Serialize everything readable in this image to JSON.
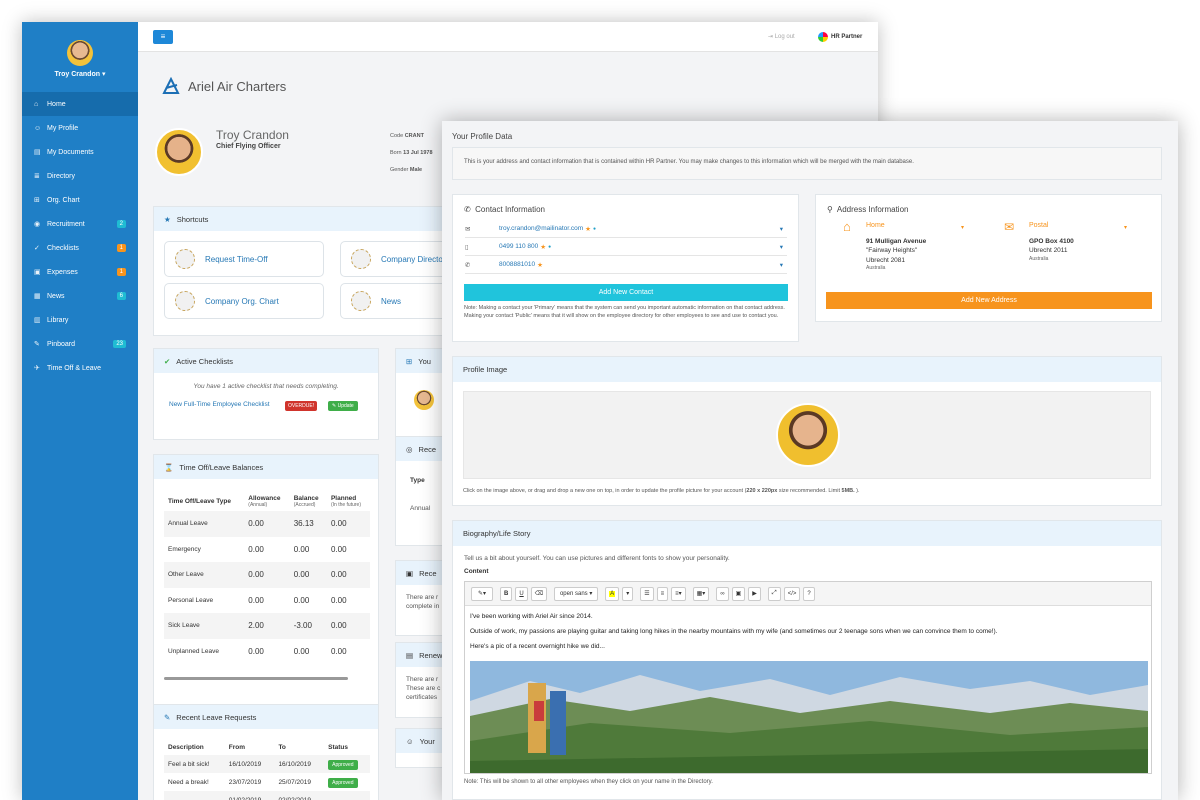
{
  "sidebar": {
    "user_name": "Troy Crandon",
    "items": [
      {
        "label": "Home",
        "icon": "home-icon",
        "glyph": "⌂"
      },
      {
        "label": "My Profile",
        "icon": "user-icon",
        "glyph": "☺"
      },
      {
        "label": "My Documents",
        "icon": "file-icon",
        "glyph": "▤"
      },
      {
        "label": "Directory",
        "icon": "list-icon",
        "glyph": "≣"
      },
      {
        "label": "Org. Chart",
        "icon": "sitemap-icon",
        "glyph": "⊞"
      },
      {
        "label": "Recruitment",
        "icon": "eye-icon",
        "glyph": "◉",
        "badge": "2",
        "badge_color": "#1fbcd3"
      },
      {
        "label": "Checklists",
        "icon": "check-icon",
        "glyph": "✓",
        "badge": "1",
        "badge_color": "#f7941d"
      },
      {
        "label": "Expenses",
        "icon": "money-icon",
        "glyph": "▣",
        "badge": "1",
        "badge_color": "#f7941d"
      },
      {
        "label": "News",
        "icon": "news-icon",
        "glyph": "▦",
        "badge": "6",
        "badge_color": "#1fbcd3"
      },
      {
        "label": "Library",
        "icon": "book-icon",
        "glyph": "▥"
      },
      {
        "label": "Pinboard",
        "icon": "pin-icon",
        "glyph": "✎",
        "badge": "23",
        "badge_color": "#1fbcd3"
      },
      {
        "label": "Time Off & Leave",
        "icon": "plane-icon",
        "glyph": "✈"
      }
    ]
  },
  "topbar": {
    "logout": "Log out",
    "brand": "HR Partner"
  },
  "company": {
    "name": "Ariel Air Charters"
  },
  "profile": {
    "name": "Troy Crandon",
    "title": "Chief Flying Officer",
    "code_label": "Code",
    "code": "CRANT",
    "born_label": "Born",
    "born": "13 Jul 1978",
    "gender_label": "Gender",
    "gender": "Male"
  },
  "shortcuts": {
    "title": "Shortcuts",
    "items": [
      "Request Time-Off",
      "Company Directory",
      "Company Org. Chart",
      "News"
    ]
  },
  "checklists": {
    "title": "Active Checklists",
    "note": "You have 1 active checklist that needs completing.",
    "item": "New Full-Time Employee Checklist",
    "overdue": "OVERDUE!",
    "update": "Update"
  },
  "balances": {
    "title": "Time Off/Leave Balances",
    "headers": [
      "Time Off/Leave Type",
      "Allowance",
      "Balance",
      "Planned"
    ],
    "subheaders": [
      "",
      "(Annual)",
      "(Accrued)",
      "(In the future)"
    ],
    "rows": [
      [
        "Annual Leave",
        "0.00",
        "36.13",
        "0.00"
      ],
      [
        "Emergency",
        "0.00",
        "0.00",
        "0.00"
      ],
      [
        "Other Leave",
        "0.00",
        "0.00",
        "0.00"
      ],
      [
        "Personal Leave",
        "0.00",
        "0.00",
        "0.00"
      ],
      [
        "Sick Leave",
        "2.00",
        "-3.00",
        "0.00"
      ],
      [
        "Unplanned Leave",
        "0.00",
        "0.00",
        "0.00"
      ]
    ]
  },
  "requests": {
    "title": "Recent Leave Requests",
    "headers": [
      "Description",
      "From",
      "To",
      "Status"
    ],
    "rows": [
      [
        "Feel a bit sick!",
        "16/10/2019",
        "16/10/2019",
        "Approved"
      ],
      [
        "Need a break!",
        "23/07/2019",
        "25/07/2019",
        "Approved"
      ],
      [
        "...",
        "01/02/2019",
        "02/02/2019",
        ""
      ]
    ]
  },
  "mid_panels": {
    "you": "You",
    "recent1": "Rece",
    "type_label": "Type",
    "annual": "Annual",
    "recent2": "Rece",
    "there1": "There are r",
    "complete": "complete in",
    "renew": "Renew",
    "there2": "There are r",
    "these": "These are c",
    "certs": "certificates",
    "your": "Your"
  },
  "front": {
    "title": "Your Profile Data",
    "info": "This is your address and contact information that is contained within HR Partner. You may make changes to this information which will be merged with the main database.",
    "contact": {
      "title": "Contact Information",
      "rows": [
        {
          "icon": "envelope-icon",
          "glyph": "✉",
          "value": "troy.crandon@mailinator.com"
        },
        {
          "icon": "mobile-icon",
          "glyph": "▯",
          "value": "0499 110 800"
        },
        {
          "icon": "phone-icon",
          "glyph": "✆",
          "value": "8008881010"
        }
      ],
      "add_button": "Add New Contact",
      "note": "Note: Making a contact your 'Primary' means that the system can send you important automatic information on that contact address. Making your contact 'Public' means that it will show on the employee directory for other employees to see and use to contact you."
    },
    "address": {
      "title": "Address Information",
      "home": {
        "label": "Home",
        "line1": "91 Mulligan Avenue",
        "line2": "\"Fairway Heights\"",
        "line3": "Ubrecht 2081",
        "country": "Australia"
      },
      "postal": {
        "label": "Postal",
        "line1": "GPO Box 4100",
        "line2": "Ubrecht 2011",
        "country": "Australia"
      },
      "add_button": "Add New Address"
    },
    "profile_image": {
      "title": "Profile Image",
      "note_pre": "Click on the image above, or drag and drop a new one on top, in order to update the profile picture for your account (",
      "note_size": "220 x 220px",
      "note_mid": " size recommended. Limit ",
      "note_limit": "5MB.",
      "note_post": " )."
    },
    "bio": {
      "title": "Biography/Life Story",
      "intro": "Tell us a bit about yourself. You can use pictures and different fonts to show your personality.",
      "content_label": "Content",
      "font": "open sans",
      "line1": "I've been working with Ariel Air since 2014.",
      "line2": "Outside of work, my passions are playing guitar and taking long hikes in the nearby mountains with my wife (and sometimes our 2 teenage sons when we can convince them to come!).",
      "line3": "Here's a pic of a recent overnight hike we did...",
      "footer": "Note: This will be shown to all other employees when they click on your name in the Directory."
    }
  },
  "colors": {
    "sidebar": "#1f7fc6",
    "accent_orange": "#f7941d",
    "teal": "#20c4dc",
    "approved": "#3fae49",
    "overdue": "#d0342c"
  }
}
